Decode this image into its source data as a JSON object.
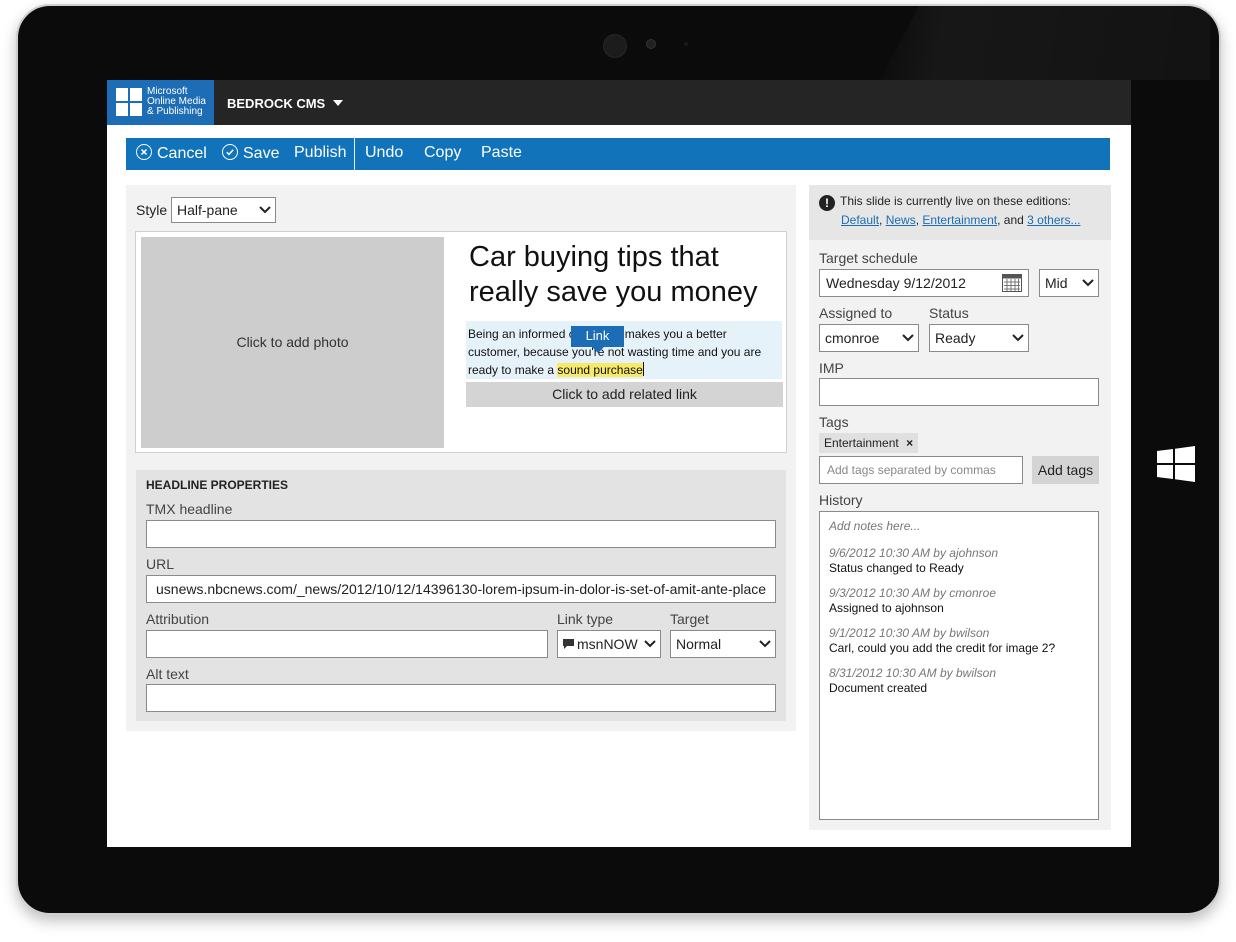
{
  "app": {
    "brand_line1": "Microsoft",
    "brand_line2": "Online Media",
    "brand_line3": "& Publishing",
    "title": "BEDROCK CMS"
  },
  "toolbar": {
    "cancel": "Cancel",
    "save": "Save",
    "publish": "Publish",
    "undo": "Undo",
    "copy": "Copy",
    "paste": "Paste"
  },
  "editor": {
    "style_label": "Style",
    "style_value": "Half-pane",
    "photo_placeholder": "Click to add photo",
    "headline": "Car buying tips that really save you money",
    "body_before": "Being an informed consumer makes you a better customer, because you're not wasting time and you are ready to make a ",
    "body_highlight": "sound purchase",
    "link_tooltip": "Link",
    "related_link": "Click to add related link"
  },
  "headline_properties": {
    "title": "HEADLINE PROPERTIES",
    "tmx_label": "TMX headline",
    "tmx_value": "",
    "url_label": "URL",
    "url_value": "usnews.nbcnews.com/_news/2012/10/12/14396130-lorem-ipsum-in-dolor-is-set-of-amit-ante-place",
    "attribution_label": "Attribution",
    "attribution_value": "",
    "link_type_label": "Link type",
    "link_type_value": "msnNOW",
    "target_label": "Target",
    "target_value": "Normal",
    "alt_label": "Alt text",
    "alt_value": ""
  },
  "sidebar": {
    "live_message": "This slide is currently live on these editions:",
    "editions": [
      "Default",
      "News",
      "Entertainment"
    ],
    "and_text": ", and ",
    "others": "3 others...",
    "schedule_label": "Target schedule",
    "schedule_date": "Wednesday  9/12/2012",
    "schedule_time": "Mid",
    "assigned_label": "Assigned to",
    "assigned_value": "cmonroe",
    "status_label": "Status",
    "status_value": "Ready",
    "imp_label": "IMP",
    "imp_value": "",
    "tags_label": "Tags",
    "tag": "Entertainment",
    "tag_remove": "×",
    "tags_placeholder": "Add tags separated by commas",
    "add_tags": "Add tags",
    "history_label": "History",
    "history_placeholder": "Add notes here...",
    "history": [
      {
        "meta": "9/6/2012  10:30 AM by ajohnson",
        "text": "Status changed to Ready"
      },
      {
        "meta": "9/3/2012  10:30 AM by cmonroe",
        "text": "Assigned to ajohnson"
      },
      {
        "meta": "9/1/2012  10:30 AM by bwilson",
        "text": "Carl, could you add the credit for image 2?"
      },
      {
        "meta": "8/31/2012  10:30 AM by bwilson",
        "text": "Document created"
      }
    ]
  },
  "colors": {
    "brand_blue": "#1c6db5",
    "toolbar_blue": "#1173b9",
    "topbar": "#252525",
    "highlight": "#f7e969"
  }
}
